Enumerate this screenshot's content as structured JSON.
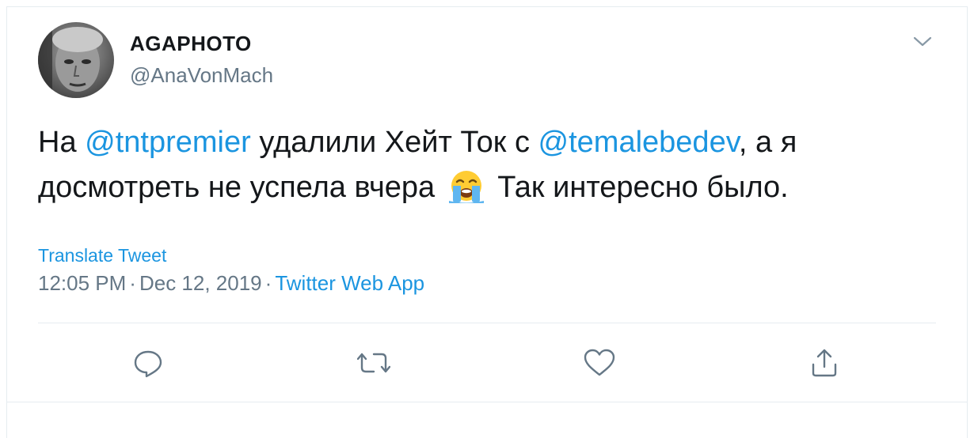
{
  "user": {
    "display_name": "AGAPHOTO",
    "handle": "@AnaVonMach"
  },
  "tweet": {
    "text_part1": "На ",
    "mention1": "@tntpremier",
    "text_part2": " удалили Хейт Ток с ",
    "mention2": "@temalebedev",
    "text_part3": ", а я досмотреть не успела вчера",
    "emoji": "loudly-crying-face",
    "text_part4": "Так интересно было."
  },
  "translate_label": "Translate Tweet",
  "meta": {
    "time": "12:05 PM",
    "separator": "·",
    "date": "Dec 12, 2019",
    "app": "Twitter Web App"
  },
  "actions": [
    {
      "name": "reply",
      "icon": "reply-icon"
    },
    {
      "name": "retweet",
      "icon": "retweet-icon"
    },
    {
      "name": "like",
      "icon": "heart-icon"
    },
    {
      "name": "share",
      "icon": "share-icon"
    }
  ],
  "colors": {
    "link": "#1b95e0",
    "secondary_text": "#657786",
    "primary_text": "#14171a",
    "border": "#e6ecf0"
  }
}
